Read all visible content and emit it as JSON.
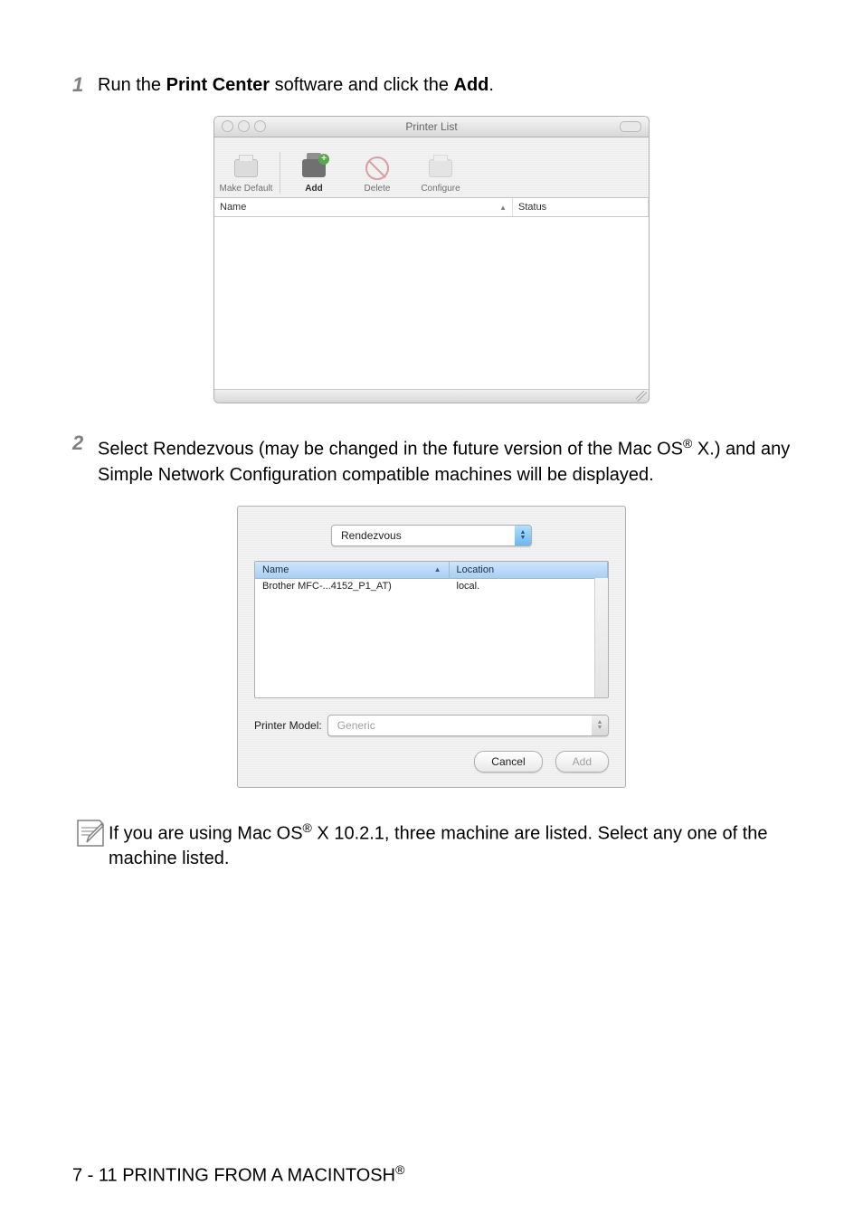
{
  "steps": {
    "s1": {
      "num": "1",
      "text_pre": "Run the ",
      "bold1": "Print Center",
      "text_mid": " software and click the ",
      "bold2": "Add",
      "text_post": "."
    },
    "s2": {
      "num": "2",
      "text_pre": "Select Rendezvous (may be changed in the future version of the Mac OS",
      "sup": "®",
      "text_post": " X.) and any Simple Network Configuration compatible machines will be displayed."
    }
  },
  "shot1": {
    "title": "Printer List",
    "tools": {
      "makeDefault": "Make Default",
      "add": "Add",
      "delete": "Delete",
      "configure": "Configure"
    },
    "cols": {
      "name": "Name",
      "status": "Status"
    }
  },
  "shot2": {
    "selector": "Rendezvous",
    "cols": {
      "name": "Name",
      "location": "Location"
    },
    "row": {
      "name": "Brother MFC-...4152_P1_AT)",
      "location": "local."
    },
    "modelLabel": "Printer Model:",
    "modelValue": "Generic",
    "cancel": "Cancel",
    "add": "Add"
  },
  "note": {
    "line1_pre": "If you are using Mac OS",
    "line1_sup": "®",
    "line1_post": " X 10.2.1, three machine are listed. Select any one of the machine listed."
  },
  "footer": {
    "text_pre": "7 - 11 PRINTING FROM A MACINTOSH",
    "sup": "®"
  }
}
